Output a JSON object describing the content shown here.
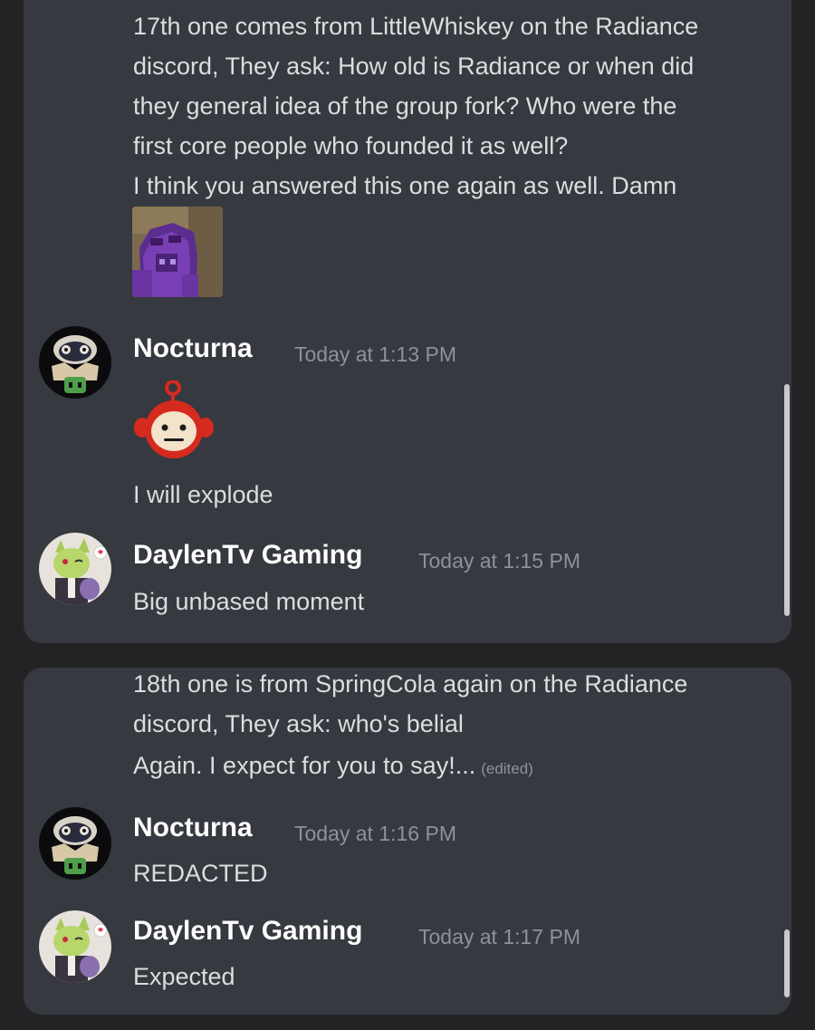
{
  "panel1": {
    "continuation_lines": [
      "17th one comes from LittleWhiskey on the Radiance",
      "discord, They ask: How old is Radiance or when did",
      "they general idea of the group fork? Who were the",
      "first core people who founded it as well?",
      "I think you answered this one again as well. Damn"
    ],
    "attachment_icon": "purple-minecraft-character-image",
    "messages": [
      {
        "username": "Nocturna",
        "timestamp": "Today at 1:13 PM",
        "emoji": "red-teletubby-face-emoji",
        "text": "I will explode",
        "avatar": "nocturna-avatar"
      },
      {
        "username": "DaylenTv Gaming",
        "timestamp": "Today at 1:15 PM",
        "text": "Big unbased moment",
        "avatar": "daylen-avatar"
      }
    ]
  },
  "panel2": {
    "continuation_lines": [
      "18th one is from SpringCola again on the Radiance",
      "discord, They ask: who's belial",
      "Again. I expect for you to say!..."
    ],
    "edited_label": "(edited)",
    "messages": [
      {
        "username": "Nocturna",
        "timestamp": "Today at 1:16 PM",
        "text": "REDACTED",
        "avatar": "nocturna-avatar"
      },
      {
        "username": "DaylenTv Gaming",
        "timestamp": "Today at 1:17 PM",
        "text": "Expected",
        "avatar": "daylen-avatar"
      }
    ]
  },
  "colors": {
    "background": "#232326",
    "panel": "#36393f",
    "text": "#dcddde",
    "username": "#ffffff",
    "timestamp": "#8e9297"
  }
}
